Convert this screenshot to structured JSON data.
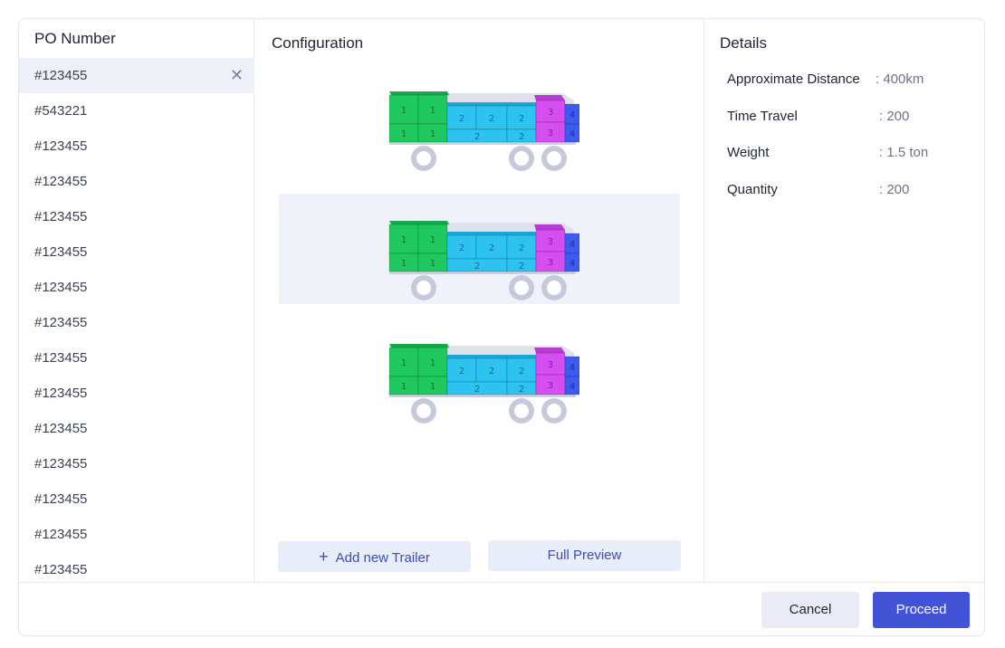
{
  "left_panel": {
    "title": "PO Number",
    "items": [
      {
        "label": "#123455",
        "selected": true
      },
      {
        "label": "#543221"
      },
      {
        "label": "#123455"
      },
      {
        "label": "#123455"
      },
      {
        "label": "#123455"
      },
      {
        "label": "#123455"
      },
      {
        "label": "#123455"
      },
      {
        "label": "#123455"
      },
      {
        "label": "#123455"
      },
      {
        "label": "#123455"
      },
      {
        "label": "#123455"
      },
      {
        "label": "#123455"
      },
      {
        "label": "#123455"
      },
      {
        "label": "#123455"
      },
      {
        "label": "#123455"
      }
    ],
    "close_icon": "close-icon"
  },
  "configuration": {
    "title": "Configuration",
    "trailers": [
      {
        "selected": false
      },
      {
        "selected": true
      },
      {
        "selected": false
      }
    ],
    "add_button": "Add new Trailer",
    "preview_button": "Full Preview",
    "box_colors": {
      "group1": "#1fc95f",
      "group2": "#2cc3f0",
      "group3": "#d64ef0",
      "group4": "#3f5af0",
      "wheels": "#c5cada",
      "bed": "#dfe2ec"
    }
  },
  "details": {
    "title": "Details",
    "rows": [
      {
        "label": "Approximate Distance",
        "value": ": 400km"
      },
      {
        "label": "Time Travel",
        "value": ": 200"
      },
      {
        "label": "Weight",
        "value": ": 1.5 ton"
      },
      {
        "label": "Quantity",
        "value": ": 200"
      }
    ]
  },
  "footer": {
    "cancel": "Cancel",
    "proceed": "Proceed"
  },
  "colors": {
    "accent": "#4253d8",
    "soft_button": "#e9ecf9",
    "selected_row": "#eef0f8"
  }
}
